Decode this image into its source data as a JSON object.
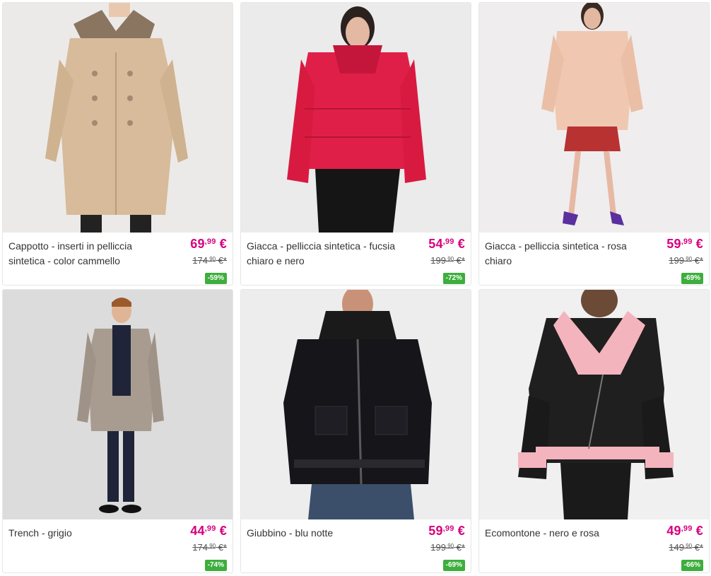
{
  "products": [
    {
      "name": "Cappotto - inserti in pelliccia sintetica - color cammello",
      "price_int": "69",
      "price_dec": ",99",
      "price_cur": " €",
      "old_int": "174",
      "old_dec": ",90",
      "old_cur": " €*",
      "discount": "-59%",
      "image_icon": "camel-coat-photo"
    },
    {
      "name": "Giacca - pelliccia sintetica - fucsia chiaro e nero",
      "price_int": "54",
      "price_dec": ",99",
      "price_cur": " €",
      "old_int": "199",
      "old_dec": ",90",
      "old_cur": " €*",
      "discount": "-72%",
      "image_icon": "fuchsia-fur-jacket-photo"
    },
    {
      "name": "Giacca - pelliccia sintetica - rosa chiaro",
      "price_int": "59",
      "price_dec": ",99",
      "price_cur": " €",
      "old_int": "199",
      "old_dec": ",90",
      "old_cur": " €*",
      "discount": "-69%",
      "image_icon": "pink-fur-jacket-photo"
    },
    {
      "name": "Trench - grigio",
      "price_int": "44",
      "price_dec": ",99",
      "price_cur": " €",
      "old_int": "174",
      "old_dec": ",90",
      "old_cur": " €*",
      "discount": "-74%",
      "image_icon": "grey-trench-photo"
    },
    {
      "name": "Giubbino - blu notte",
      "price_int": "59",
      "price_dec": ",99",
      "price_cur": " €",
      "old_int": "199",
      "old_dec": ",90",
      "old_cur": " €*",
      "discount": "-69%",
      "image_icon": "navy-jacket-photo"
    },
    {
      "name": "Ecomontone - nero e rosa",
      "price_int": "49",
      "price_dec": ",99",
      "price_cur": " €",
      "old_int": "149",
      "old_dec": ",90",
      "old_cur": " €*",
      "discount": "-66%",
      "image_icon": "black-pink-shearling-photo"
    }
  ],
  "colors": {
    "price": "#d6007f",
    "discount_badge": "#3dae3d"
  }
}
